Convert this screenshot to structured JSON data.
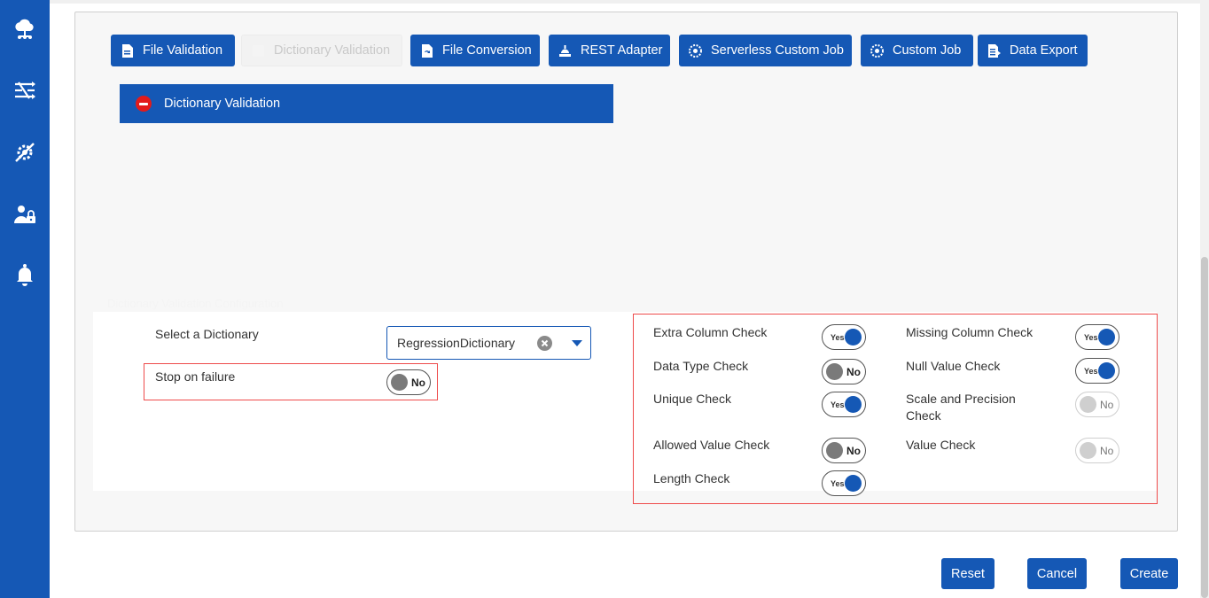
{
  "sidebar": {
    "items": [
      {
        "icon": "cloud-network-icon"
      },
      {
        "icon": "shuffle-flow-icon"
      },
      {
        "icon": "settings-tools-icon"
      },
      {
        "icon": "user-lock-icon"
      },
      {
        "icon": "bell-icon"
      }
    ]
  },
  "job_types": {
    "file_validation": "File Validation",
    "dictionary_validation": "Dictionary Validation",
    "file_conversion": "File Conversion",
    "rest_adapter": "REST Adapter",
    "serverless_custom_job": "Serverless Custom Job",
    "custom_job": "Custom Job",
    "data_export": "Data Export"
  },
  "selected_job": {
    "label": "Dictionary Validation"
  },
  "config": {
    "section_title": "Dictionary Validation Configuration",
    "select_dictionary_label": "Select a Dictionary",
    "select_dictionary_value": "RegressionDictionary",
    "stop_on_failure_label": "Stop on failure",
    "stop_on_failure_value": "No",
    "checks": {
      "extra_column": {
        "label": "Extra Column Check",
        "value": "Yes"
      },
      "missing_column": {
        "label": "Missing Column Check",
        "value": "Yes"
      },
      "data_type": {
        "label": "Data Type Check",
        "value": "No"
      },
      "null_value": {
        "label": "Null Value Check",
        "value": "Yes"
      },
      "unique": {
        "label": "Unique Check",
        "value": "Yes"
      },
      "scale_precision": {
        "label": "Scale and Precision Check",
        "value": "No"
      },
      "allowed_value": {
        "label": "Allowed Value Check",
        "value": "No"
      },
      "value": {
        "label": "Value Check",
        "value": "No"
      },
      "length": {
        "label": "Length Check",
        "value": "Yes"
      }
    }
  },
  "actions": {
    "reset": "Reset",
    "cancel": "Cancel",
    "create": "Create"
  },
  "colors": {
    "primary": "#1558b5",
    "highlight_border": "#ee4b4b",
    "error_badge": "#e21b1b"
  }
}
